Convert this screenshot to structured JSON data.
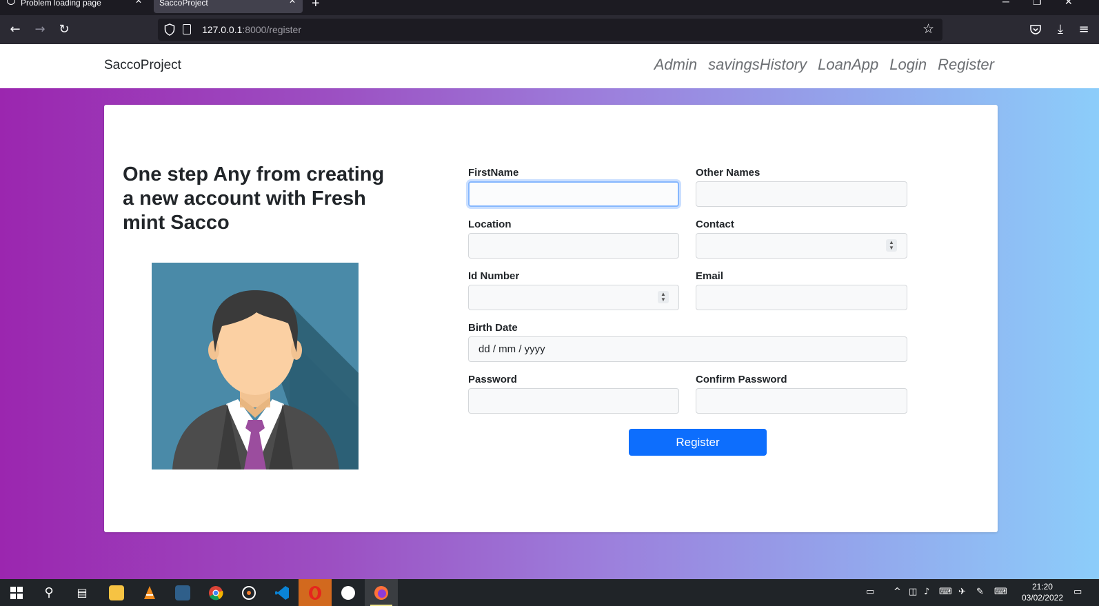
{
  "browser": {
    "tabs": [
      {
        "label": "Problem loading page",
        "active": false
      },
      {
        "label": "SaccoProject",
        "active": true
      }
    ],
    "url_host": "127.0.0.1",
    "url_rest": ":8000/register"
  },
  "site": {
    "brand": "SaccoProject",
    "nav": [
      "Admin",
      "savingsHistory",
      "LoanApp",
      "Login",
      "Register"
    ]
  },
  "main": {
    "heading": "One step Any from creating a new account with Fresh mint Sacco",
    "avatar_icon": "businessman-avatar-icon"
  },
  "form": {
    "firstname_label": "FirstName",
    "othernames_label": "Other Names",
    "location_label": "Location",
    "contact_label": "Contact",
    "idnumber_label": "Id Number",
    "email_label": "Email",
    "birthdate_label": "Birth Date",
    "birthdate_placeholder": "dd / mm / yyyy",
    "password_label": "Password",
    "confirm_password_label": "Confirm Password",
    "submit_label": "Register"
  },
  "taskbar": {
    "time": "21:20",
    "date": "03/02/2022",
    "apps": [
      "start-icon",
      "search-icon",
      "task-view-icon",
      "file-explorer-icon",
      "vlc-icon",
      "mysql-workbench-icon",
      "chrome-icon",
      "media-icon",
      "vscode-icon",
      "opera-icon",
      "word-icon",
      "firefox-icon"
    ]
  },
  "colors": {
    "accent": "#0d6efd",
    "gradient_start": "#9b26af",
    "gradient_end": "#8ccdfa"
  }
}
